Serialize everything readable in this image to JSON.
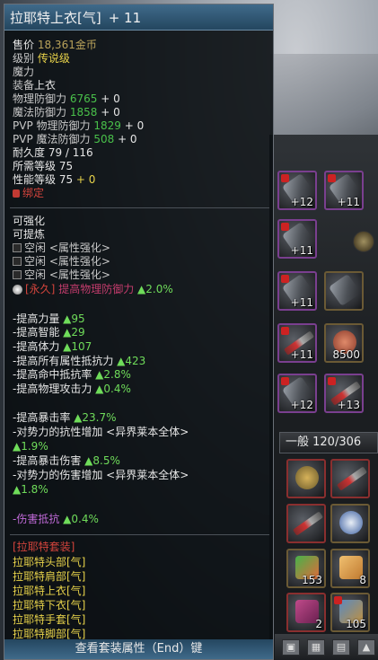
{
  "tooltip": {
    "item_name": "拉耶特上衣[气]",
    "enhance": "+ 11",
    "price_label": "售价",
    "price_value": "18,361金币",
    "grade_label": "级别",
    "grade_value": "传说级",
    "line_magic": "魔力",
    "line_slot_label": "装备",
    "line_slot_value": "上衣",
    "phys_def_label": "物理防御力",
    "phys_def_value": "6765",
    "phys_def_bonus": "+ 0",
    "mag_def_label": "魔法防御力",
    "mag_def_value": "1858",
    "mag_def_bonus": "+ 0",
    "pvp_phys_label": "PVP 物理防御力",
    "pvp_phys_value": "1829",
    "pvp_phys_bonus": "+ 0",
    "pvp_mag_label": "PVP 魔法防御力",
    "pvp_mag_value": "508",
    "pvp_mag_bonus": "+ 0",
    "durability": "耐久度 79 / 116",
    "req_level": "所需等级 75",
    "perf_level_label": "性能等级 75",
    "perf_level_bonus": "+ 0",
    "bound": "绑定",
    "can_enhance": "可强化",
    "can_refine": "可提炼",
    "slots": [
      "空闲 <属性强化>",
      "空闲 <属性强化>",
      "空闲 <属性强化>"
    ],
    "perm_prefix": "[永久]",
    "perm_text": "提高物理防御力",
    "perm_value": "▲2.0%",
    "stats_a": [
      {
        "label": "-提高力量",
        "value": "▲95"
      },
      {
        "label": "-提高智能",
        "value": "▲29"
      },
      {
        "label": "-提高体力",
        "value": "▲107"
      },
      {
        "label": "-提高所有属性抵抗力",
        "value": "▲423"
      },
      {
        "label": "-提高命中抵抗率",
        "value": "▲2.8%"
      },
      {
        "label": "-提高物理攻击力",
        "value": "▲0.4%"
      }
    ],
    "stats_b": [
      {
        "label": "-提高暴击率",
        "value": "▲23.7%"
      },
      {
        "label": "-对势力的抗性增加 <异界莱本全体>",
        "value": ""
      },
      {
        "label": "",
        "value": "▲1.9%"
      },
      {
        "label": "-提高暴击伤害",
        "value": "▲8.5%"
      },
      {
        "label": "-对势力的伤害增加 <异界莱本全体>",
        "value": ""
      },
      {
        "label": "",
        "value": "▲1.8%"
      }
    ],
    "special_label": "-伤害抵抗",
    "special_value": "▲0.4%",
    "set_title": "[拉耶特套装]",
    "set_items": [
      "拉耶特头部[气]",
      "拉耶特肩部[气]",
      "拉耶特上衣[气]",
      "拉耶特下衣[气]",
      "拉耶特手套[气]",
      "拉耶特脚部[气]"
    ],
    "footer": "查看套装属性（End）键"
  },
  "inventory": {
    "tab_label": "一般 120/306",
    "slot_counts": [
      "+12",
      "+11",
      "+11",
      "+11",
      "+11",
      "8500",
      "+12",
      "+13",
      "153",
      "8",
      "2",
      "105"
    ]
  },
  "colors": {
    "accent_green": "#49c04a",
    "gold": "#b9a25a",
    "set_yellow": "#e7d24a",
    "warning_red": "#d3443c"
  }
}
